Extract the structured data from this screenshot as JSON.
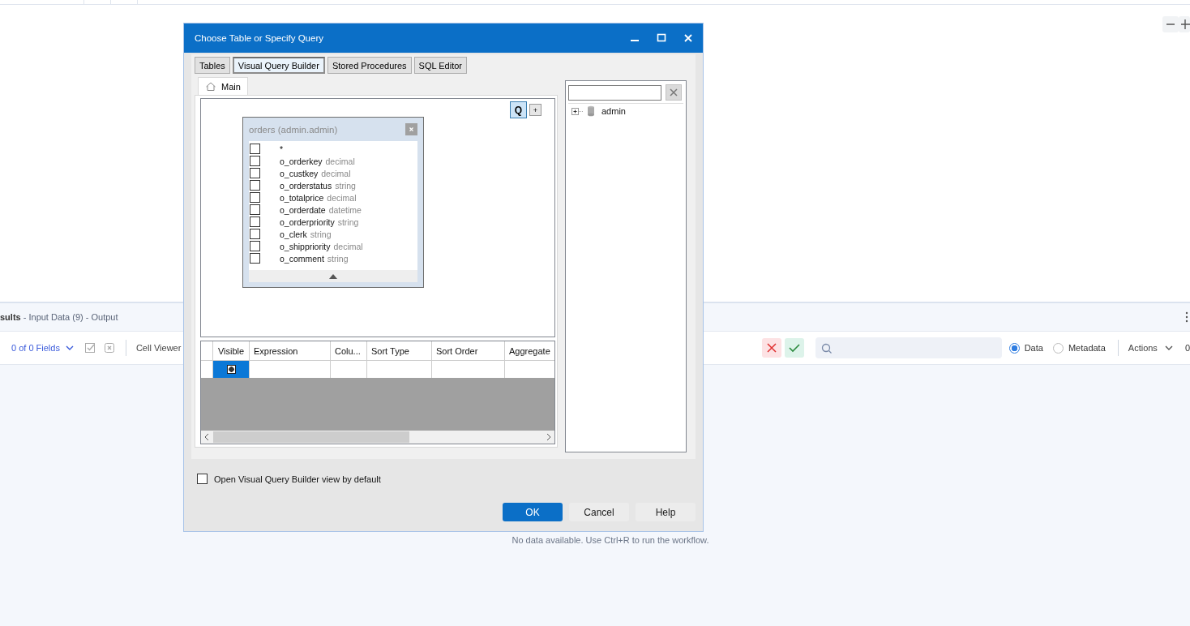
{
  "results": {
    "title": "**sults** - Input Data (9) - Output"
  },
  "toolbar": {
    "fields": "0 of 0 Fields",
    "cell_viewer": "Cell Viewer",
    "radios": [
      {
        "label": "Data",
        "selected": true
      },
      {
        "label": "Metadata",
        "selected": false
      }
    ],
    "actions": "Actions",
    "count": "0"
  },
  "empty_message": "No data available. Use Ctrl+R to run the workflow.",
  "dialog": {
    "title": "Choose Table or Specify Query",
    "tabs": [
      {
        "label": "Tables",
        "selected": false
      },
      {
        "label": "Visual Query Builder",
        "selected": true
      },
      {
        "label": "Stored Procedures",
        "selected": false
      },
      {
        "label": "SQL Editor",
        "selected": false
      }
    ],
    "subtabs": [
      {
        "label": "Main",
        "selected": true
      }
    ],
    "canvas_buttons": [
      "Q",
      "+"
    ],
    "table_box": {
      "title": "orders (admin.admin)",
      "fields": [
        {
          "name": "*",
          "checked": false
        },
        {
          "name": "o_orderkey",
          "type": "decimal",
          "checked": false
        },
        {
          "name": "o_custkey",
          "type": "decimal",
          "checked": false
        },
        {
          "name": "o_orderstatus",
          "type": "string",
          "checked": false
        },
        {
          "name": "o_totalprice",
          "type": "decimal",
          "checked": false
        },
        {
          "name": "o_orderdate",
          "type": "datetime",
          "checked": false
        },
        {
          "name": "o_orderpriority",
          "type": "string",
          "checked": false
        },
        {
          "name": "o_clerk",
          "type": "string",
          "checked": false
        },
        {
          "name": "o_shippriority",
          "type": "decimal",
          "checked": false
        },
        {
          "name": "o_comment",
          "type": "string",
          "checked": false
        }
      ]
    },
    "grid": {
      "columns": [
        "Visible",
        "Expression",
        "Colu...",
        "Sort Type",
        "Sort Order",
        "Aggregate"
      ],
      "rows": [
        {
          "visible": true,
          "selected": true
        }
      ]
    },
    "tree": [
      {
        "label": "admin",
        "expanded": false
      }
    ],
    "default_view": {
      "label": "Open Visual Query Builder view by default",
      "checked": false
    },
    "buttons": [
      {
        "label": "OK",
        "kind": "primary"
      },
      {
        "label": "Cancel",
        "kind": "normal"
      },
      {
        "label": "Help",
        "kind": "normal"
      }
    ]
  }
}
